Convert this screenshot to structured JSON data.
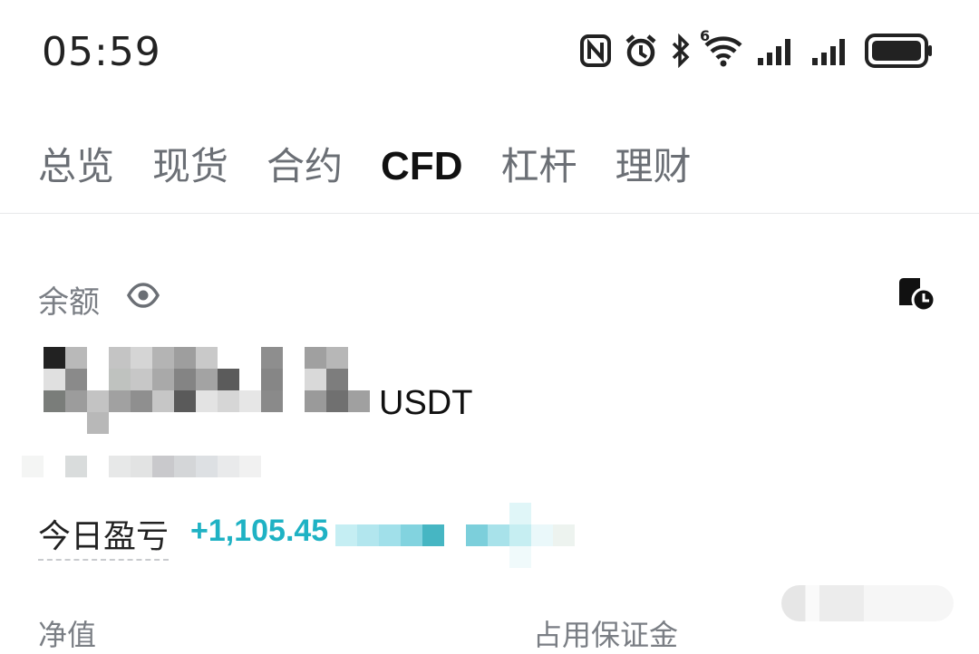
{
  "status_bar": {
    "time": "05:59",
    "icons": [
      "nfc-icon",
      "alarm-icon",
      "bluetooth-icon",
      "wifi-6-icon",
      "signal-icon",
      "signal-icon",
      "battery-icon"
    ],
    "wifi_badge": "6"
  },
  "tabs": [
    {
      "label": "总览",
      "active": false
    },
    {
      "label": "现货",
      "active": false
    },
    {
      "label": "合约",
      "active": false
    },
    {
      "label": "CFD",
      "active": true
    },
    {
      "label": "杠杆",
      "active": false
    },
    {
      "label": "理财",
      "active": false
    }
  ],
  "balance": {
    "label": "余额",
    "unit": "USDT",
    "eye_icon": "eye-icon",
    "history_icon": "wallet-history-icon"
  },
  "today_pnl": {
    "label": "今日盈亏",
    "value": "+1,105.45",
    "color": "#1fb2c4"
  },
  "bottom": {
    "left_label": "净值",
    "right_label": "占用保证金"
  }
}
